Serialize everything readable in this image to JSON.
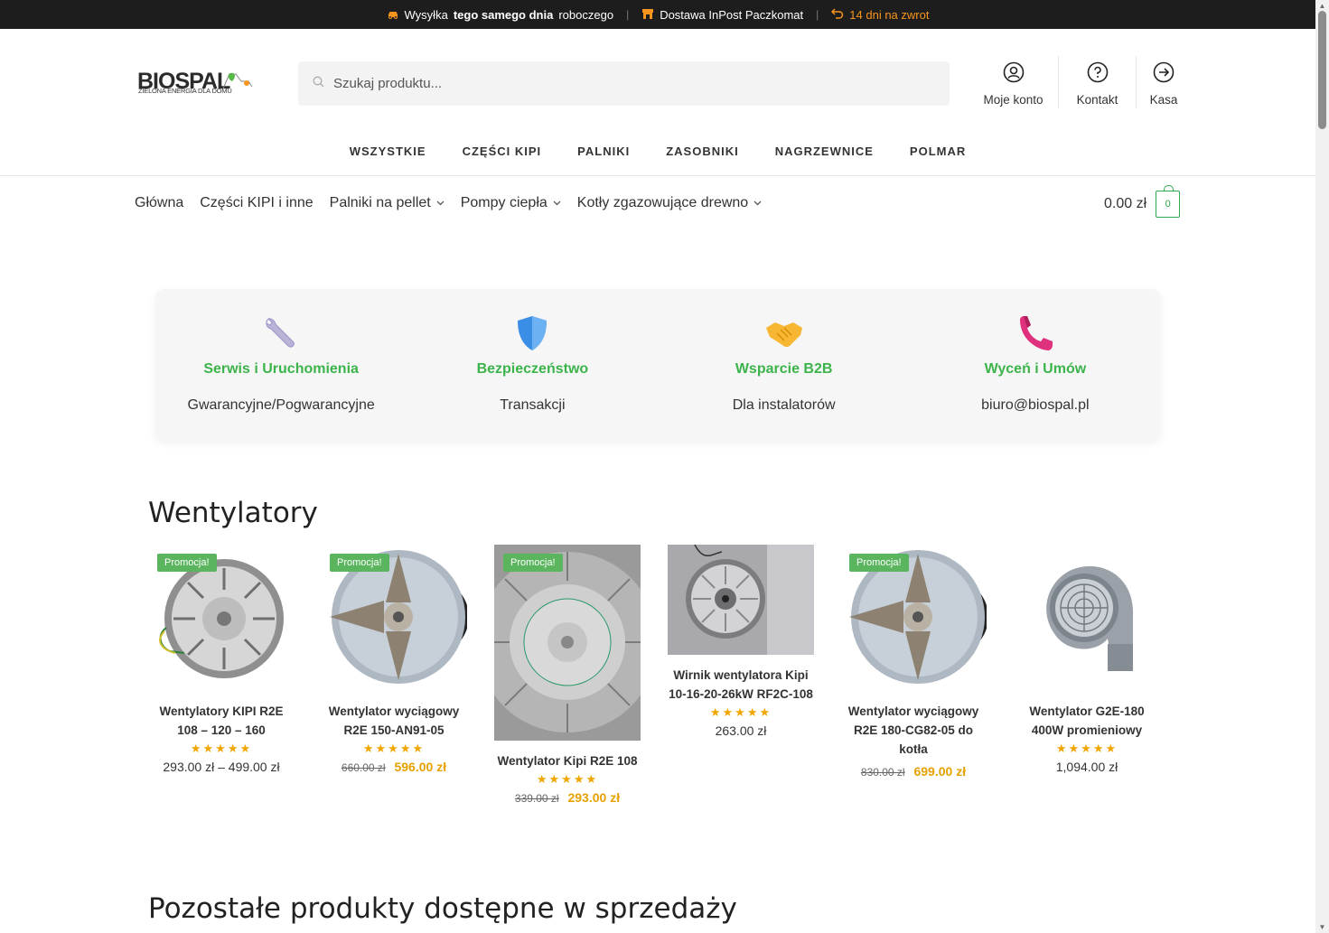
{
  "topbar": {
    "item1_pre": "Wysyłka",
    "item1_bold": "tego samego dnia",
    "item1_post": "roboczego",
    "item2": "Dostawa InPost Paczkomat",
    "item3": "14 dni na zwrot",
    "separator": "|"
  },
  "logo": {
    "name": "BIOSPAL",
    "tagline": "ZIELONA ENERGIA DLA DOMU"
  },
  "search": {
    "placeholder": "Szukaj produktu..."
  },
  "header_links": {
    "account": "Moje konto",
    "contact": "Kontakt",
    "checkout": "Kasa"
  },
  "category_nav": [
    "WSZYSTKIE",
    "CZĘŚCI KIPI",
    "PALNIKI",
    "ZASOBNIKI",
    "NAGRZEWNICE",
    "POLMAR"
  ],
  "main_nav": [
    {
      "label": "Główna",
      "has_dropdown": false
    },
    {
      "label": "Części KIPI i inne",
      "has_dropdown": false
    },
    {
      "label": "Palniki na pellet",
      "has_dropdown": true
    },
    {
      "label": "Pompy ciepła",
      "has_dropdown": true
    },
    {
      "label": "Kotły zgazowujące drewno",
      "has_dropdown": true
    }
  ],
  "cart": {
    "amount": "0.00 zł",
    "count": "0"
  },
  "features": [
    {
      "icon": "wrench-icon",
      "title": "Serwis i Uruchomienia",
      "subtitle": "Gwarancyjne/Pogwarancyjne"
    },
    {
      "icon": "shield-icon",
      "title": "Bezpieczeństwo",
      "subtitle": "Transakcji"
    },
    {
      "icon": "handshake-icon",
      "title": "Wsparcie B2B",
      "subtitle": "Dla instalatorów"
    },
    {
      "icon": "phone-icon",
      "title": "Wyceń i Umów",
      "subtitle": "biuro@biospal.pl"
    }
  ],
  "section_title": "Wentylatory",
  "section2_title": "Pozostałe produkty dostępne w sprzedaży",
  "badge_label": "Promocja!",
  "stars": "★★★★★",
  "products": [
    {
      "name": "Wentylatory KIPI R2E 108 – 120 – 160",
      "promo": true,
      "price": "293.00 zł – 499.00 zł",
      "old_price": "",
      "new_price": "",
      "rating": 5
    },
    {
      "name": "Wentylator wyciągowy R2E 150-AN91-05",
      "promo": true,
      "price": "",
      "old_price": "660.00 zł",
      "new_price": "596.00 zł",
      "rating": 5
    },
    {
      "name": "Wentylator Kipi R2E 108",
      "promo": true,
      "price": "",
      "old_price": "339.00 zł",
      "new_price": "293.00 zł",
      "rating": 5
    },
    {
      "name": "Wirnik wentylatora Kipi 10-16-20-26kW RF2C-108",
      "promo": false,
      "price": "263.00 zł",
      "old_price": "",
      "new_price": "",
      "rating": 4.5
    },
    {
      "name": "Wentylator wyciągowy R2E 180-CG82-05 do kotła",
      "promo": true,
      "price": "",
      "old_price": "830.00 zł",
      "new_price": "699.00 zł",
      "rating": 0
    },
    {
      "name": "Wentylator G2E-180 400W promieniowy",
      "promo": false,
      "price": "1,094.00 zł",
      "old_price": "",
      "new_price": "",
      "rating": 5
    }
  ],
  "colors": {
    "accent_green": "#3cb44b",
    "price_orange": "#e6a100",
    "topbar_bg": "#1d1d1d",
    "badge_green": "#5ab55e"
  }
}
